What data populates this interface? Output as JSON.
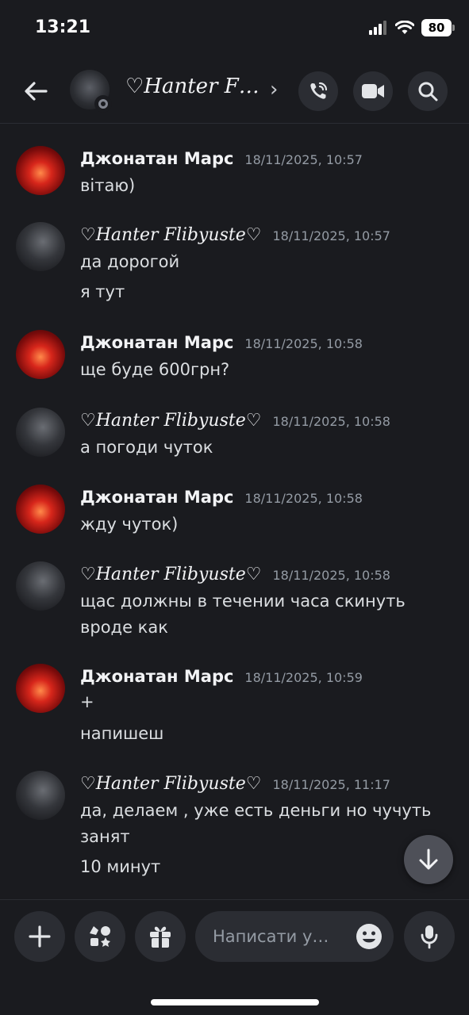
{
  "status_bar": {
    "time": "13:21",
    "battery": "80"
  },
  "header": {
    "title": "♡Hanter F…",
    "chevron": "›"
  },
  "messages": [
    {
      "author": "Джонатан Марс",
      "timestamp": "18/11/2025, 10:57",
      "lines": [
        "вітаю)"
      ]
    },
    {
      "author": "♡Hanter Flibyuste♡",
      "timestamp": "18/11/2025, 10:57",
      "lines": [
        "да дорогой",
        "я тут"
      ]
    },
    {
      "author": "Джонатан Марс",
      "timestamp": "18/11/2025, 10:58",
      "lines": [
        "ще буде 600грн?"
      ]
    },
    {
      "author": "♡Hanter Flibyuste♡",
      "timestamp": "18/11/2025, 10:58",
      "lines": [
        "а погоди чуток"
      ]
    },
    {
      "author": "Джонатан Марс",
      "timestamp": "18/11/2025, 10:58",
      "lines": [
        "жду чуток)"
      ]
    },
    {
      "author": "♡Hanter Flibyuste♡",
      "timestamp": "18/11/2025, 10:58",
      "lines": [
        "щас должны в течении часа скинуть",
        "вроде как"
      ]
    },
    {
      "author": "Джонатан Марс",
      "timestamp": "18/11/2025, 10:59",
      "lines": [
        "+",
        "напишеш"
      ]
    },
    {
      "author": "♡Hanter Flibyuste♡",
      "timestamp": "18/11/2025, 11:17",
      "lines": [
        "да, делаем , уже есть деньги но чучуть",
        "занят",
        "10 минут"
      ]
    }
  ],
  "composer": {
    "placeholder": "Написати у…"
  },
  "icons": {
    "back": "arrow-left-icon",
    "call": "phone-call-icon",
    "video": "video-camera-icon",
    "search": "search-icon",
    "scroll": "arrow-down-icon",
    "add": "plus-icon",
    "apps": "apps-icon",
    "gift": "gift-icon",
    "emoji": "emoji-icon",
    "mic": "microphone-icon"
  },
  "colors": {
    "background": "#1a1b1f",
    "button": "#2b2d33",
    "timestamp": "#949ba4"
  }
}
